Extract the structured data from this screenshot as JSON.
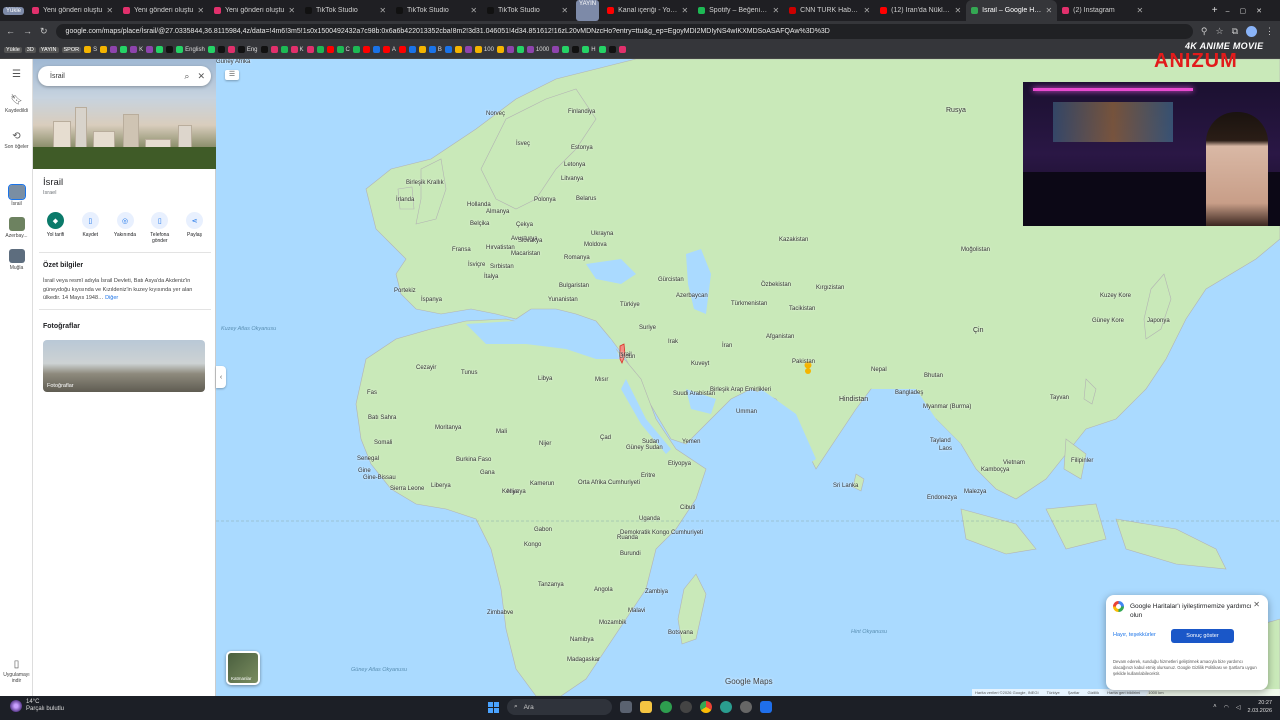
{
  "browser": {
    "tabs": [
      {
        "label": "Yeni gönderi oluştu",
        "color": "#e1306c"
      },
      {
        "label": "Yeni gönderi oluştu",
        "color": "#e1306c"
      },
      {
        "label": "Yeni gönderi oluştu",
        "color": "#e1306c"
      },
      {
        "label": "TikTok Studio",
        "color": "#111111"
      },
      {
        "label": "TikTok Studio",
        "color": "#111111"
      },
      {
        "label": "TikTok Studio",
        "color": "#111111"
      },
      {
        "label": "Kanal içeriği - YouTu",
        "color": "#ff0000"
      },
      {
        "label": "Spotify – Beğenilen",
        "color": "#1db954"
      },
      {
        "label": "CNN TÜRK Haber - S",
        "color": "#cc0000"
      },
      {
        "label": "(12) İran'da Nükleer",
        "color": "#ff0000"
      },
      {
        "label": "İsrail – Google Harit",
        "color": "#34a853",
        "active": true
      },
      {
        "label": "(2) Instagram",
        "color": "#e1306c"
      }
    ],
    "group_chips": [
      "Yükle",
      "YAYIN"
    ],
    "url": "google.com/maps/place/İsrail/@27.0335844,36.8115984,4z/data=!4m6!3m5!1s0x1500492432a7c98b:0x6a6b422013352cba!8m2!3d31.046051!4d34.851612!16zL20vMDNzcHo?entry=ttu&g_ep=EgoyMDI2MDIyNS4wIKXMDSoASAFQAw%3D%3D",
    "bookmarks": [
      "Yükle",
      "3D",
      "YAYIN",
      "SPOR",
      "S",
      "K",
      "English",
      "Eng",
      "K",
      "C",
      "A",
      "B",
      "100",
      "1000",
      "H"
    ]
  },
  "maps": {
    "search_query": "İsrail",
    "place_title": "İsrail",
    "place_subtitle": "Israel",
    "actions": [
      "Yol tarifi",
      "Kaydet",
      "Yakınında",
      "Telefona gönder",
      "Paylaş"
    ],
    "summary_heading": "Özet bilgiler",
    "summary_text": "İsrail veya resmî adıyla İsrail Devleti, Batı Asya'da Akdeniz'in güneydoğu kıyısında ve Kızıldeniz'in kuzey kıyısında yer alan ülkedir. 14 Mayıs 1948…",
    "summary_more": "Diğer",
    "photos_heading": "Fotoğraflar",
    "photos_label": "Fotoğraflar",
    "rail": [
      {
        "label": "Kaydedildi",
        "icon": "bookmark-icon"
      },
      {
        "label": "Son öğeler",
        "icon": "history-icon"
      },
      {
        "label": "İsrail",
        "icon": "thumbnail"
      },
      {
        "label": "Azerbay...",
        "icon": "thumbnail"
      },
      {
        "label": "Muğla",
        "icon": "thumbnail"
      },
      {
        "label": "Uygulamayı indir",
        "icon": "phone-icon"
      }
    ],
    "layers_label": "Katmanlar",
    "google_logo": "Google Maps",
    "attribution": [
      "Harita verileri ©2026 Google, INEGI",
      "Türkiye",
      "Şartlar",
      "Gizlilik",
      "Harita geri bildirimi",
      "1000 km"
    ],
    "labels": {
      "countries": [
        {
          "t": "Rusya"
        },
        {
          "t": "Finlandiya"
        },
        {
          "t": "Norveç"
        },
        {
          "t": "İsveç"
        },
        {
          "t": "Estonya"
        },
        {
          "t": "Letonya"
        },
        {
          "t": "Litvanya"
        },
        {
          "t": "Belarus"
        },
        {
          "t": "Polonya"
        },
        {
          "t": "Almanya"
        },
        {
          "t": "Hollanda"
        },
        {
          "t": "Belçika"
        },
        {
          "t": "Birleşik Krallık"
        },
        {
          "t": "İrlanda"
        },
        {
          "t": "Fransa"
        },
        {
          "t": "İspanya"
        },
        {
          "t": "Portekiz"
        },
        {
          "t": "İtalya"
        },
        {
          "t": "İsviçre"
        },
        {
          "t": "Avusturya"
        },
        {
          "t": "Çekya"
        },
        {
          "t": "Slovakya"
        },
        {
          "t": "Macaristan"
        },
        {
          "t": "Romanya"
        },
        {
          "t": "Moldova"
        },
        {
          "t": "Ukrayna"
        },
        {
          "t": "Sırbistan"
        },
        {
          "t": "Bulgaristan"
        },
        {
          "t": "Hırvatistan"
        },
        {
          "t": "Yunanistan"
        },
        {
          "t": "Türkiye"
        },
        {
          "t": "Gürcistan"
        },
        {
          "t": "Azerbaycan"
        },
        {
          "t": "Kazakistan"
        },
        {
          "t": "Özbekistan"
        },
        {
          "t": "Türkmenistan"
        },
        {
          "t": "Kırgızistan"
        },
        {
          "t": "Tacikistan"
        },
        {
          "t": "Moğolistan"
        },
        {
          "t": "Çin"
        },
        {
          "t": "Kuzey Kore"
        },
        {
          "t": "Güney Kore"
        },
        {
          "t": "Japonya"
        },
        {
          "t": "Afganistan"
        },
        {
          "t": "Pakistan"
        },
        {
          "t": "Nepal"
        },
        {
          "t": "Bhutan"
        },
        {
          "t": "Hindistan"
        },
        {
          "t": "Bangladeş"
        },
        {
          "t": "Myanmar (Burma)"
        },
        {
          "t": "Tayland"
        },
        {
          "t": "Laos"
        },
        {
          "t": "Vietnam"
        },
        {
          "t": "Kamboçya"
        },
        {
          "t": "Tayvan"
        },
        {
          "t": "Filipinler"
        },
        {
          "t": "Malezya"
        },
        {
          "t": "Endonezya"
        },
        {
          "t": "Sri Lanka"
        },
        {
          "t": "İran"
        },
        {
          "t": "Irak"
        },
        {
          "t": "Suriye"
        },
        {
          "t": "Ürdün"
        },
        {
          "t": "İsrail"
        },
        {
          "t": "Kuveyt"
        },
        {
          "t": "Suudi Arabistan"
        },
        {
          "t": "Birleşik Arap Emirlikleri"
        },
        {
          "t": "Umman"
        },
        {
          "t": "Yemen"
        },
        {
          "t": "Mısır"
        },
        {
          "t": "Libya"
        },
        {
          "t": "Tunus"
        },
        {
          "t": "Cezayir"
        },
        {
          "t": "Fas"
        },
        {
          "t": "Batı Sahra"
        },
        {
          "t": "Moritanya"
        },
        {
          "t": "Mali"
        },
        {
          "t": "Nijer"
        },
        {
          "t": "Çad"
        },
        {
          "t": "Sudan"
        },
        {
          "t": "Eritre"
        },
        {
          "t": "Etiyopya"
        },
        {
          "t": "Cibuti"
        },
        {
          "t": "Somali"
        },
        {
          "t": "Senegal"
        },
        {
          "t": "Gine"
        },
        {
          "t": "Gine-Bissau"
        },
        {
          "t": "Sierra Leone"
        },
        {
          "t": "Liberya"
        },
        {
          "t": "Burkina Faso"
        },
        {
          "t": "Gana"
        },
        {
          "t": "Nijerya"
        },
        {
          "t": "Kamerun"
        },
        {
          "t": "Orta Afrika Cumhuriyeti"
        },
        {
          "t": "Güney Sudan"
        },
        {
          "t": "Uganda"
        },
        {
          "t": "Kenya"
        },
        {
          "t": "Gabon"
        },
        {
          "t": "Kongo"
        },
        {
          "t": "Demokratik Kongo Cumhuriyeti"
        },
        {
          "t": "Ruanda"
        },
        {
          "t": "Burundi"
        },
        {
          "t": "Tanzanya"
        },
        {
          "t": "Angola"
        },
        {
          "t": "Zambiya"
        },
        {
          "t": "Malavi"
        },
        {
          "t": "Mozambik"
        },
        {
          "t": "Zimbabve"
        },
        {
          "t": "Namibya"
        },
        {
          "t": "Botsvana"
        },
        {
          "t": "Madagaskar"
        },
        {
          "t": "Güney Afrika"
        }
      ],
      "seas": [
        "Kuzey Atlas Okyanusu",
        "Güney Atlas Okyanusu",
        "Hint Okyanusu"
      ]
    },
    "feedback_popup": {
      "title": "Google Haritalar'ı iyileştirmemize yardımcı olun",
      "no_label": "Hayır, teşekkürler",
      "yes_label": "Sonuç göster",
      "footer": "Devam ederek, sunduğu hizmetleri geliştirmek amacıyla bize yardımcı olacağınızı kabul etmiş olursunuz. Google Gizlilik Politikası ve Şartlar'a uygun şekilde kullanılabilecektir."
    }
  },
  "overlay": {
    "logo_line1": "4K ANIME MOVIE",
    "logo_line2": "ANIZUM"
  },
  "taskbar": {
    "weather_temp": "14°C",
    "weather_desc": "Parçalı bulutlu",
    "search_placeholder": "Ara",
    "time": "20:27",
    "date": "2.03.2026"
  }
}
